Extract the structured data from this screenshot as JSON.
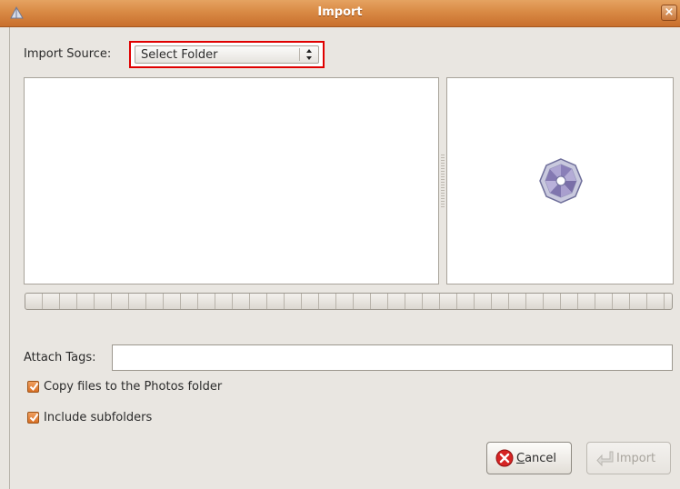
{
  "window": {
    "title": "Import",
    "close_glyph": "×"
  },
  "source": {
    "label": "Import Source:",
    "selected": "Select Folder",
    "arrows": "▲\n▼"
  },
  "preview": {
    "icon": "f-spot-spinner-icon"
  },
  "progress": {
    "fraction": 0
  },
  "tags": {
    "label": "Attach Tags:",
    "value": "",
    "placeholder": ""
  },
  "options": {
    "copy_files": {
      "label": "Copy files to the Photos folder",
      "checked": true
    },
    "include_subfolders": {
      "label": "Include subfolders",
      "checked": true
    }
  },
  "buttons": {
    "cancel_label": "Cancel",
    "cancel_mnemonic": "C",
    "cancel_rest": "ancel",
    "import_label": "Import",
    "import_enabled": false
  },
  "colors": {
    "title_bar": "#d98a45",
    "accent": "#e00000",
    "checkbox": "#e07a2e"
  }
}
